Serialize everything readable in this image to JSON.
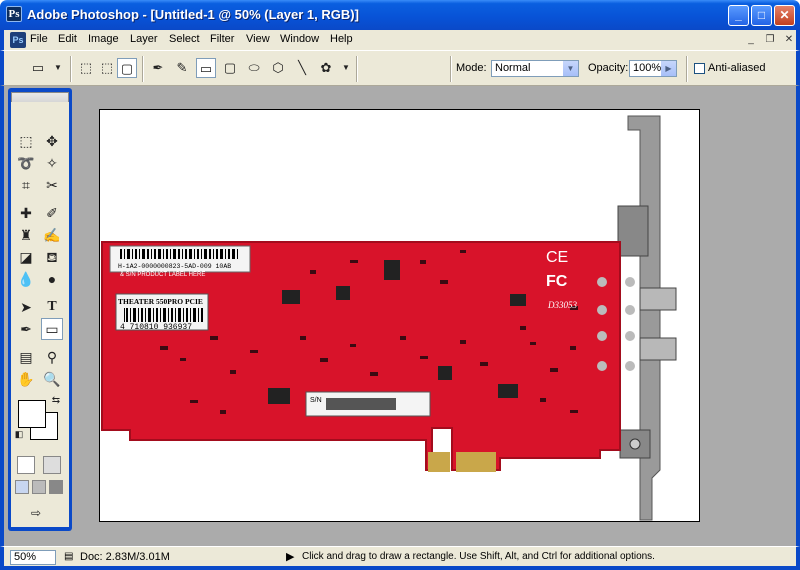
{
  "window": {
    "title": "Adobe Photoshop - [Untitled-1 @ 50% (Layer 1, RGB)]",
    "minimize": "_",
    "maximize": "□",
    "close": "✕"
  },
  "menubar": {
    "items": [
      "File",
      "Edit",
      "Image",
      "Layer",
      "Select",
      "Filter",
      "View",
      "Window",
      "Help"
    ],
    "doc_minimize": "_",
    "doc_restore": "❐",
    "doc_close": "✕"
  },
  "options": {
    "mode_label": "Mode:",
    "mode_value": "Normal",
    "opacity_label": "Opacity:",
    "opacity_value": "100%",
    "antialiased_label": "Anti-aliased",
    "antialiased_checked": false
  },
  "canvas": {
    "card_texts": {
      "serial_barcode": "H-1A2-0000000823-5AD-009 10AB",
      "label_here": "& S/N PRODUCT LABEL HERE",
      "model": "THEATER 550PRO PCIE",
      "ean": "4 710810 936937",
      "ce_mark": "CE",
      "fcc_mark": "FC",
      "part_no": "D33053",
      "sn_label": "S/N"
    },
    "colors": {
      "pcb": "#d8132a",
      "pcb_dark": "#a30c1d",
      "bracket": "#9a9a9a",
      "gold": "#c9a74a"
    }
  },
  "status": {
    "zoom": "50%",
    "doc_size": "Doc: 2.83M/3.01M",
    "hint": "Click and drag to draw a rectangle.  Use Shift, Alt, and Ctrl for additional options."
  }
}
